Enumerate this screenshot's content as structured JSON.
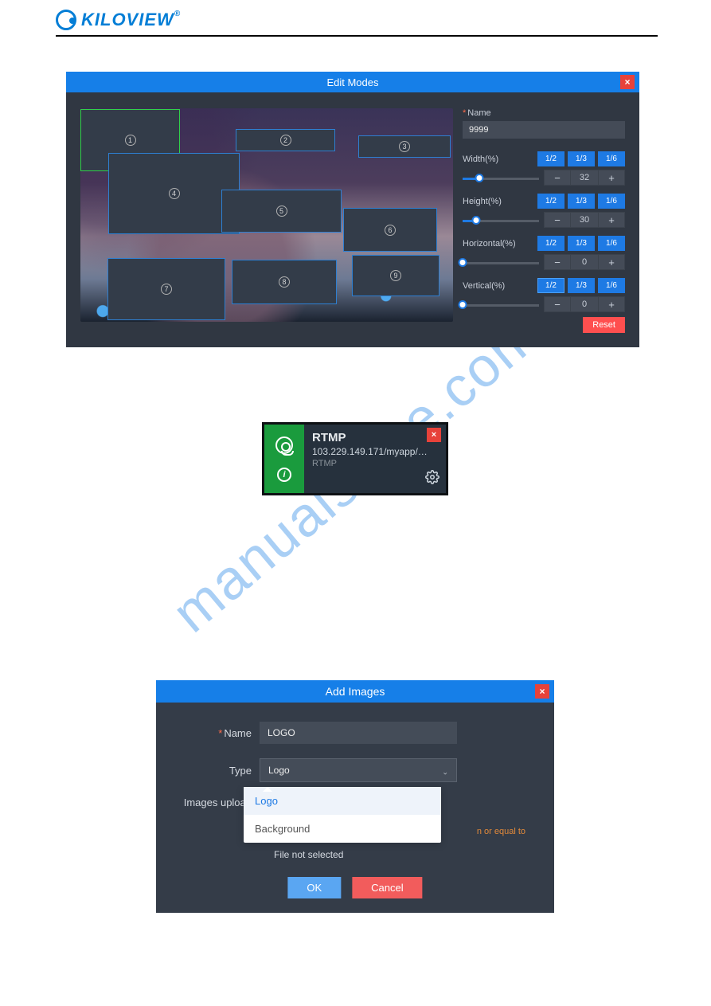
{
  "brand": {
    "name": "KILOVIEW"
  },
  "watermark": "manualshive.com",
  "editModes": {
    "title": "Edit Modes",
    "close": "×",
    "name_label": "Name",
    "name_value": "9999",
    "windows": [
      "1",
      "2",
      "3",
      "4",
      "5",
      "6",
      "7",
      "8",
      "9"
    ],
    "fractions": [
      "1/2",
      "1/3",
      "1/6"
    ],
    "width": {
      "label": "Width(%)",
      "value": "32",
      "active": "",
      "sliderPercent": 22
    },
    "height": {
      "label": "Height(%)",
      "value": "30",
      "active": "",
      "sliderPercent": 18
    },
    "horizontal": {
      "label": "Horizontal(%)",
      "value": "0",
      "active": "",
      "sliderPercent": 0
    },
    "vertical": {
      "label": "Vertical(%)",
      "value": "0",
      "active": "1/2",
      "sliderPercent": 0
    },
    "reset": "Reset",
    "minus": "−",
    "plus": "+"
  },
  "rtmp": {
    "title": "RTMP",
    "url": "103.229.149.171/myapp/…",
    "proto": "RTMP",
    "close": "×",
    "info_glyph": "i"
  },
  "addImages": {
    "title": "Add Images",
    "close": "×",
    "name_label": "Name",
    "name_value": "LOGO",
    "type_label": "Type",
    "type_selected": "Logo",
    "type_options": [
      "Logo",
      "Background"
    ],
    "upload_label": "Images upload",
    "hint": "n or equal to",
    "file_note": "File not selected",
    "ok": "OK",
    "cancel": "Cancel",
    "chev": "⌃"
  }
}
